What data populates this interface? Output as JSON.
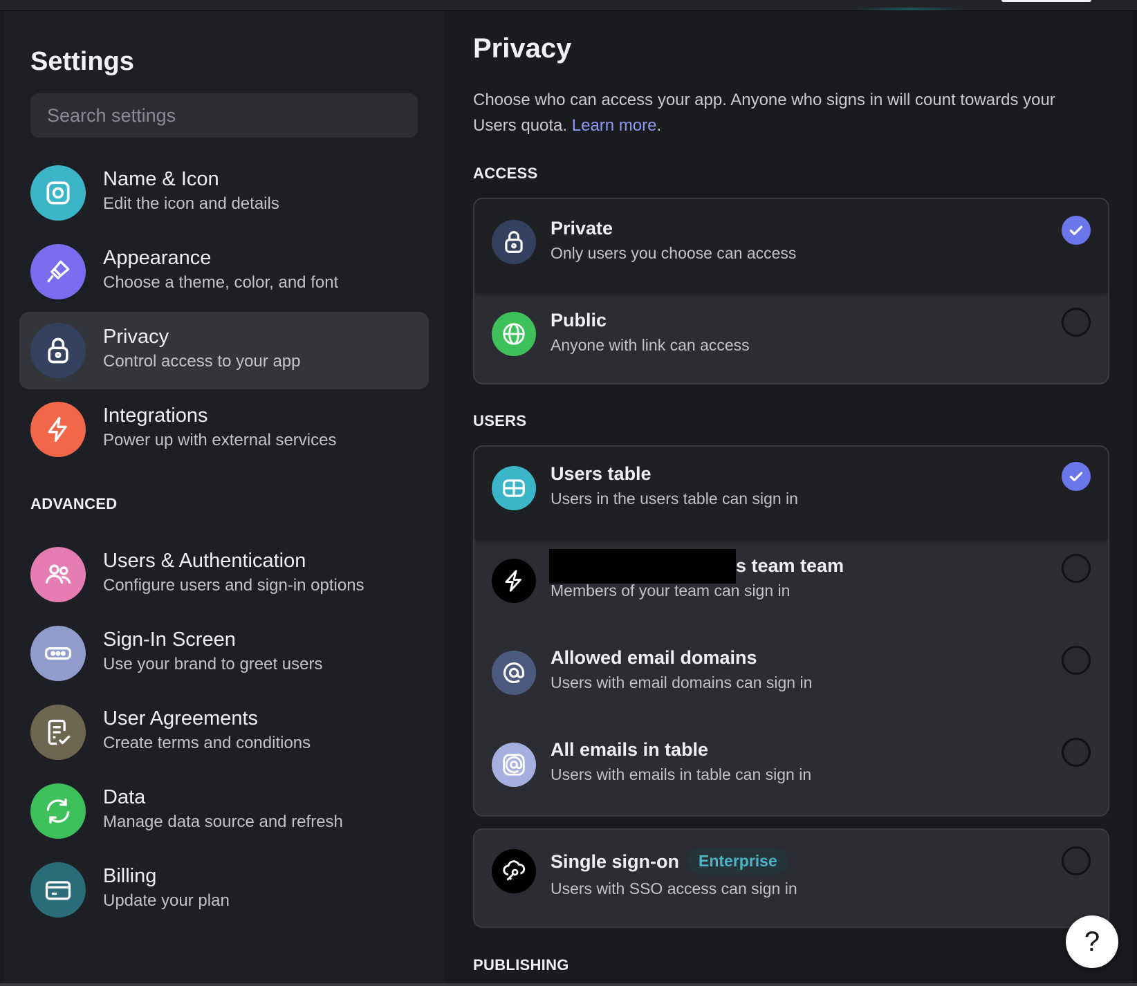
{
  "sidebar": {
    "title": "Settings",
    "search_placeholder": "Search settings",
    "items": [
      {
        "label": "Name & Icon",
        "desc": "Edit the icon and details",
        "icon": "app-icon",
        "color": "#3bb6c9"
      },
      {
        "label": "Appearance",
        "desc": "Choose a theme, color, and font",
        "icon": "brush-icon",
        "color": "#7b6cf0"
      },
      {
        "label": "Privacy",
        "desc": "Control access to your app",
        "icon": "lock-icon",
        "color": "#33415f"
      },
      {
        "label": "Integrations",
        "desc": "Power up with external services",
        "icon": "lightning-icon",
        "color": "#f2674a"
      }
    ],
    "advanced_label": "ADVANCED",
    "advanced_items": [
      {
        "label": "Users & Authentication",
        "desc": "Configure users and sign-in options",
        "icon": "users-icon",
        "color": "#e57cb4"
      },
      {
        "label": "Sign-In Screen",
        "desc": "Use your brand to greet users",
        "icon": "password-icon",
        "color": "#8f9ccc"
      },
      {
        "label": "User Agreements",
        "desc": "Create terms and conditions",
        "icon": "document-check-icon",
        "color": "#6e6650"
      },
      {
        "label": "Data",
        "desc": "Manage data source and refresh",
        "icon": "refresh-icon",
        "color": "#3ec15a"
      },
      {
        "label": "Billing",
        "desc": "Update your plan",
        "icon": "credit-card-icon",
        "color": "#2a6d78"
      }
    ]
  },
  "main": {
    "title": "Privacy",
    "description": "Choose who can access your app. Anyone who signs in will count towards your Users quota.",
    "learn_more": "Learn more",
    "period": ".",
    "access_label": "ACCESS",
    "access_options": [
      {
        "label": "Private",
        "desc": "Only users you choose can access",
        "icon": "lock-icon",
        "color": "#33415f",
        "selected": true
      },
      {
        "label": "Public",
        "desc": "Anyone with link can access",
        "icon": "globe-icon",
        "color": "#3ec15a",
        "selected": false
      }
    ],
    "users_label": "USERS",
    "users_options": [
      {
        "label": "Users table",
        "desc": "Users in the users table can sign in",
        "icon": "table-icon",
        "color": "#3bb6c9",
        "selected": true
      },
      {
        "label": "s team team",
        "desc": "Members of your team can sign in",
        "icon": "glide-logo-icon",
        "color": "#000000",
        "selected": false
      },
      {
        "label": "Allowed email domains",
        "desc": "Users with email domains can sign in",
        "icon": "at-sign-icon",
        "color": "#4c5a80",
        "selected": false
      },
      {
        "label": "All emails in table",
        "desc": "Users with emails in table can sign in",
        "icon": "at-sign-box-icon",
        "color": "#a5b0e0",
        "selected": false
      }
    ],
    "sso": {
      "label": "Single sign-on",
      "badge": "Enterprise",
      "desc": "Users with SSO access can sign in",
      "icon": "cloud-key-icon",
      "color": "#000000",
      "selected": false
    },
    "publishing_label": "PUBLISHING"
  },
  "help": {
    "label": "?"
  },
  "colors": {
    "accent": "#6b76ea",
    "link": "#8f98f2",
    "badge_text": "#4fb3c3"
  }
}
